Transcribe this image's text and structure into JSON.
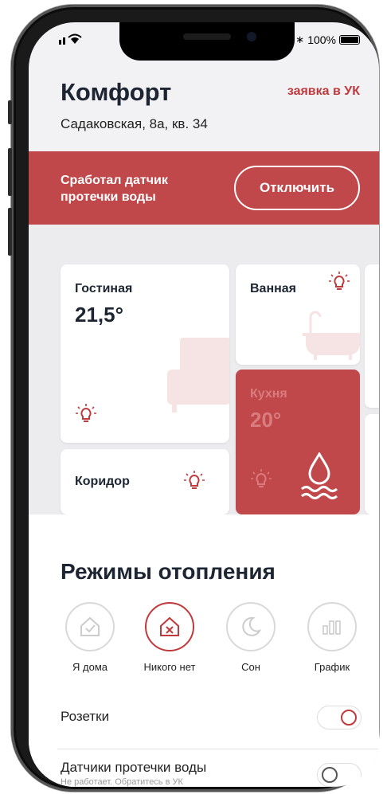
{
  "status": {
    "battery": "100%"
  },
  "header": {
    "title": "Комфорт",
    "address": "Садаковская, 8а, кв. 34",
    "request_link": "заявка в УК"
  },
  "alert": {
    "message": "Сработал датчик протечки воды",
    "button": "Отключить"
  },
  "rooms": [
    {
      "name": "Гостиная",
      "temp": "21,5°"
    },
    {
      "name": "Ванная"
    },
    {
      "name": "Кухня",
      "temp": "20°"
    },
    {
      "name": "Коридор"
    }
  ],
  "modes": {
    "title": "Режимы отопления",
    "items": [
      {
        "label": "Я дома",
        "icon": "home-check-icon"
      },
      {
        "label": "Никого нет",
        "icon": "home-cross-icon",
        "active": true
      },
      {
        "label": "Сон",
        "icon": "moon-icon"
      },
      {
        "label": "График",
        "icon": "schedule-bars-icon"
      }
    ]
  },
  "toggles": [
    {
      "label": "Розетки",
      "on": true
    },
    {
      "label": "Датчики протечки воды",
      "sublabel": "Не работает. Обратитесь в УК",
      "on": false
    }
  ],
  "colors": {
    "accent": "#c0393c",
    "alert_bg": "#c0474a",
    "card_active": "#c0474a"
  }
}
